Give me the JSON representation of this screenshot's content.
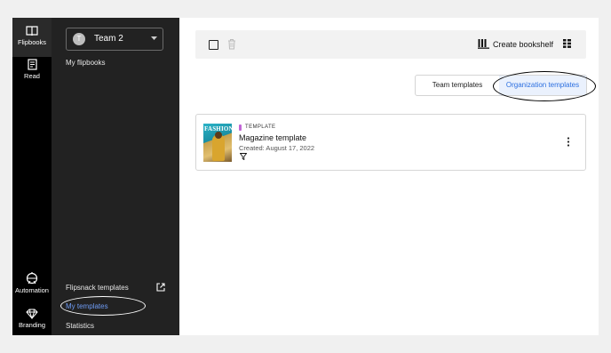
{
  "rail": {
    "items": [
      {
        "label": "Flipbooks",
        "icon": "book-icon",
        "active": true
      },
      {
        "label": "Read",
        "icon": "read-icon"
      },
      {
        "label": "Automation",
        "icon": "automation-icon"
      },
      {
        "label": "Branding",
        "icon": "diamond-icon"
      }
    ]
  },
  "sidebar": {
    "team": {
      "name": "Team 2",
      "avatar_initial": "T"
    },
    "links": {
      "my_flipbooks": "My flipbooks",
      "flipsnack_templates": "Flipsnack templates",
      "my_templates": "My templates",
      "statistics": "Statistics"
    }
  },
  "toolbar": {
    "create_bookshelf": "Create bookshelf"
  },
  "tabs": {
    "team": "Team templates",
    "org": "Organization templates",
    "active": "org",
    "active_color": "#2b6fe0"
  },
  "card": {
    "tag": "TEMPLATE",
    "tag_color": "#c265d6",
    "title": "Magazine template",
    "created": "Created: August 17, 2022",
    "thumb_masthead": "FASHION"
  }
}
